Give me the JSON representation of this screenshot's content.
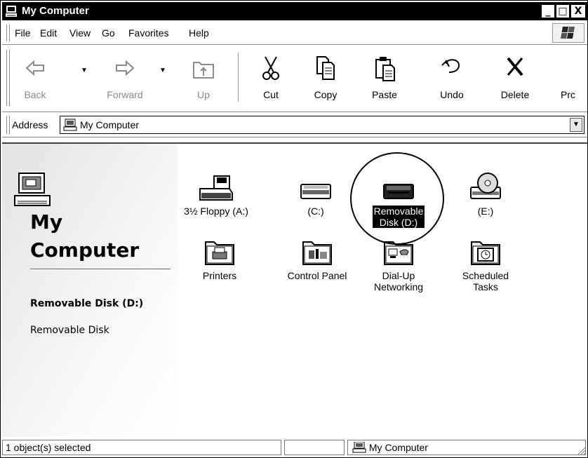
{
  "window": {
    "title": "My Computer",
    "controls": {
      "minimize": "_",
      "maximize": "□",
      "close": "X"
    }
  },
  "menu": {
    "items": [
      {
        "label": "File"
      },
      {
        "label": "Edit"
      },
      {
        "label": "View"
      },
      {
        "label": "Go"
      },
      {
        "label": "Favorites"
      },
      {
        "label": "Help"
      }
    ]
  },
  "toolbar": {
    "buttons": [
      {
        "label": "Back",
        "icon": "back-arrow-icon",
        "enabled": false
      },
      {
        "label": "Forward",
        "icon": "forward-arrow-icon",
        "enabled": false
      },
      {
        "label": "Up",
        "icon": "up-folder-icon",
        "enabled": false
      },
      {
        "label": "Cut",
        "icon": "scissors-icon",
        "enabled": true
      },
      {
        "label": "Copy",
        "icon": "copy-icon",
        "enabled": true
      },
      {
        "label": "Paste",
        "icon": "paste-icon",
        "enabled": true
      },
      {
        "label": "Undo",
        "icon": "undo-icon",
        "enabled": true
      },
      {
        "label": "Delete",
        "icon": "delete-x-icon",
        "enabled": true
      },
      {
        "label": "Prc",
        "icon": "properties-icon",
        "enabled": true
      }
    ]
  },
  "address": {
    "label": "Address",
    "value": "My Computer",
    "icon": "computer-icon"
  },
  "webview": {
    "title_line1": "My",
    "title_line2": "Computer",
    "selected_name": "Removable Disk (D:)",
    "selected_type": "Removable Disk"
  },
  "items": [
    {
      "label": "3½ Floppy (A:)",
      "icon": "floppy-drive-icon",
      "selected": false
    },
    {
      "label": "(C:)",
      "icon": "hard-drive-icon",
      "selected": false
    },
    {
      "label_line1": "Removable",
      "label_line2": "Disk (D:)",
      "icon": "removable-disk-icon",
      "selected": true
    },
    {
      "label": "(E:)",
      "icon": "cd-drive-icon",
      "selected": false
    },
    {
      "label": "Printers",
      "icon": "printers-folder-icon",
      "selected": false
    },
    {
      "label": "Control Panel",
      "icon": "control-panel-folder-icon",
      "selected": false
    },
    {
      "label_line1": "Dial-Up",
      "label_line2": "Networking",
      "icon": "dialup-networking-folder-icon",
      "selected": false
    },
    {
      "label_line1": "Scheduled",
      "label_line2": "Tasks",
      "icon": "scheduled-tasks-folder-icon",
      "selected": false
    }
  ],
  "status": {
    "selection": "1 object(s) selected",
    "location": "My Computer"
  }
}
